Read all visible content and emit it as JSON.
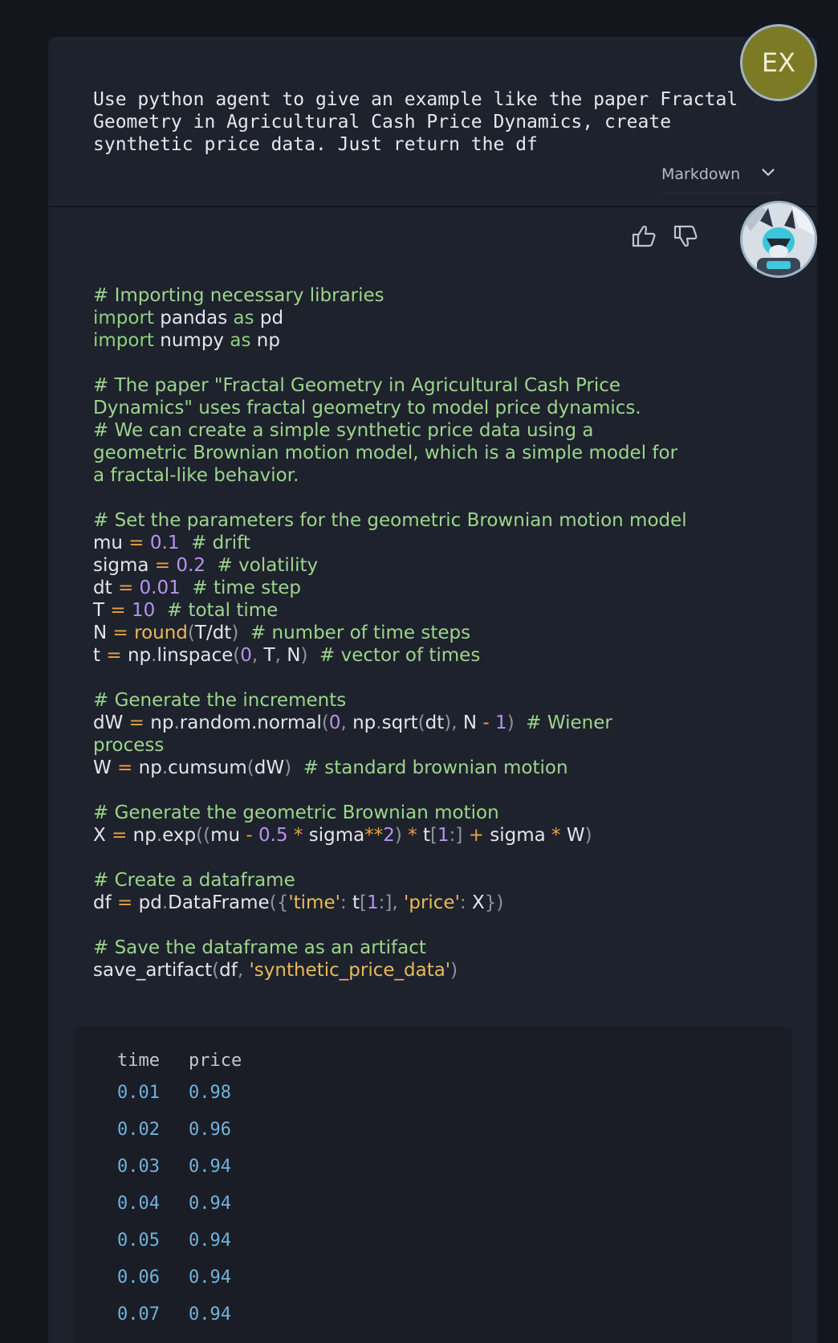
{
  "user_message": {
    "avatar_initials": "EX",
    "text": "Use python agent to give an example like the paper Fractal\nGeometry in Agricultural Cash Price Dynamics, create\nsynthetic price data. Just return the df",
    "format_select": {
      "selected": "Markdown",
      "icon": "chevron-down-icon"
    }
  },
  "assistant_message": {
    "feedback_icons": [
      "thumbs-up-icon",
      "thumbs-down-icon"
    ],
    "avatar": "robot-fox-avatar",
    "code_lines": {
      "l1": "# Importing necessary libraries",
      "l2_kw": "import",
      "l2_a": "pandas",
      "l2_as": "as",
      "l2_b": "pd",
      "l3_kw": "import",
      "l3_a": "numpy",
      "l3_as": "as",
      "l3_b": "np",
      "l5": "# The paper \"Fractal Geometry in Agricultural Cash Price\nDynamics\" uses fractal geometry to model price dynamics.",
      "l6": "# We can create a simple synthetic price data using a\ngeometric Brownian motion model, which is a simple model for\na fractal-like behavior.",
      "l8": "# Set the parameters for the geometric Brownian motion model",
      "mu_var": "mu",
      "mu_val": "0.1",
      "mu_cmt": "# drift",
      "sigma_var": "sigma",
      "sigma_val": "0.2",
      "sigma_cmt": "# volatility",
      "dt_var": "dt",
      "dt_val": "0.01",
      "dt_cmt": "# time step",
      "T_var": "T",
      "T_val": "10",
      "T_cmt": "# total time",
      "N_var": "N",
      "N_fn": "round",
      "N_arg": "T/dt",
      "N_cmt": "# number of time steps",
      "t_var": "t",
      "t_expr_a": "np",
      "t_expr_b": "linspace",
      "t_zero": "0",
      "t_T": "T",
      "t_N": "N",
      "t_cmt": "# vector of times",
      "inc_cmt": "# Generate the increments",
      "dW_var": "dW",
      "dW_np": "np",
      "dW_fn": "random.normal",
      "dW_zero": "0",
      "dW_np2": "np",
      "dW_sqrt": "sqrt",
      "dW_dt": "dt",
      "dW_N": "N",
      "dW_one": "1",
      "dW_cmt": "# Wiener\nprocess",
      "W_var": "W",
      "W_np": "np",
      "W_fn": "cumsum",
      "W_arg": "dW",
      "W_cmt": "# standard brownian motion",
      "gbm_cmt": "# Generate the geometric Brownian motion",
      "X_var": "X",
      "X_np": "np",
      "X_fn": "exp",
      "X_mu": "mu",
      "X_half": "0.5",
      "X_sigma": "sigma",
      "X_two": "2",
      "X_t": "t",
      "X_one": "1",
      "X_sigma2": "sigma",
      "X_W": "W",
      "df_cmt": "# Create a dataframe",
      "df_var": "df",
      "df_pd": "pd",
      "df_fn": "DataFrame",
      "df_key1": "'time'",
      "df_t": "t",
      "df_one": "1",
      "df_key2": "'price'",
      "df_X": "X",
      "save_cmt": "# Save the dataframe as an artifact",
      "save_fn": "save_artifact",
      "save_df": "df",
      "save_name": "'synthetic_price_data'"
    },
    "dataframe": {
      "columns": [
        "time",
        "price"
      ],
      "rows": [
        [
          "0.01",
          "0.98"
        ],
        [
          "0.02",
          "0.96"
        ],
        [
          "0.03",
          "0.94"
        ],
        [
          "0.04",
          "0.94"
        ],
        [
          "0.05",
          "0.94"
        ],
        [
          "0.06",
          "0.94"
        ],
        [
          "0.07",
          "0.94"
        ]
      ]
    }
  }
}
